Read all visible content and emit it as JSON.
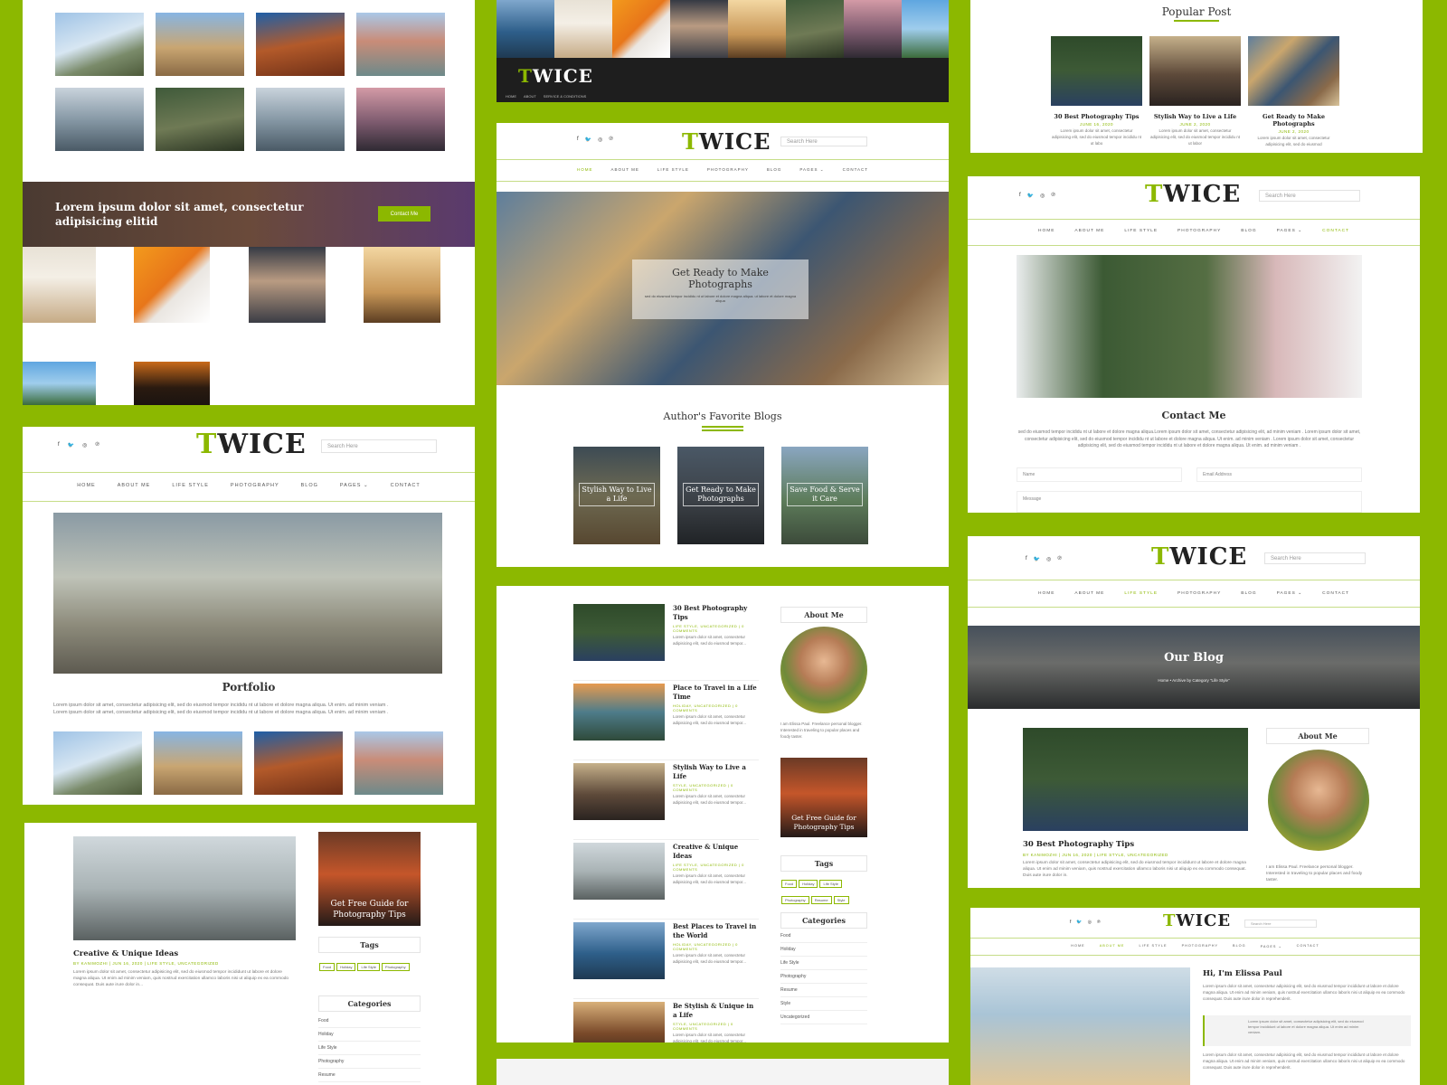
{
  "brand": {
    "logo_t": "T",
    "logo_rest": "WICE",
    "accent": "#8cb800",
    "background": "#8cb800"
  },
  "nav": {
    "home": "HOME",
    "about": "ABOUT ME",
    "lifestyle": "LIFE STYLE",
    "photography": "PHOTOGRAPHY",
    "blog": "BLOG",
    "pages": "PAGES ⌄",
    "contact": "CONTACT"
  },
  "topnav_small": {
    "a": "HOME",
    "b": "ABOUT",
    "c": "SERVICE & CONDITIONS"
  },
  "search": {
    "placeholder": "Search Here",
    "placeholder_small": "Search Here"
  },
  "social": {
    "facebook": "f",
    "twitter": "🐦",
    "instagram": "◎",
    "pinterest": "℗"
  },
  "banner": {
    "text": "Lorem ipsum dolor sit amet, consectetur adipisicing elitid",
    "button": "Contact Me"
  },
  "hero": {
    "title": "Get Ready to Make Photographs",
    "text": "sed do eiusmod tempor incididu nt ut labore et dolore magna aliqua. ut labore et dolore magna aliqua"
  },
  "author_section": {
    "title": "Author's Favorite Blogs",
    "cards": [
      "Stylish Way to Live a Life",
      "Get Ready to Make Photographs",
      "Save Food & Serve it Care"
    ]
  },
  "portfolio": {
    "title": "Portfolio",
    "text1": "Lorem ipsum dolor sit amet, consectetur adipisicing elit, sed do eiusmod tempor incididu nt ut labore et dolore magna aliqua. Ut enim. ad minim veniam .",
    "text2": "Lorem ipsum dolor sit amet, consectetur adipisicing elit, sed do eiusmod tempor incididu nt ut labore et dolore magna aliqua. Ut enim. ad minim veniam ."
  },
  "popular": {
    "title": "Popular Post",
    "posts": [
      {
        "title": "30 Best Photography Tips",
        "date": "JUNE 16, 2020",
        "text": "Lorem ipsum dolor sit amet, consectetur adipisicing elit, sed do eiusmod tempor incididu nt ut labo"
      },
      {
        "title": "Stylish Way to Live a Life",
        "date": "JUNE 2, 2020",
        "text": "Lorem ipsum dolor sit amet, consectetur adipisicing elit, sed do eiusmod tempor incididu nt ut labor"
      },
      {
        "title": "Get Ready to Make Photographs",
        "date": "JUNE 2, 2020",
        "text": "Lorem ipsum dolor sit amet, consectetur adipisicing elit, sed do eiusmod"
      }
    ]
  },
  "contact": {
    "title": "Contact Me",
    "text": "sed do eiusmod tempor incididu nt ut labore et dolore magna aliqua.Lorem ipsum dolor sit amet, consectetur adipisicing elit, ad minim veniam . Lorem ipsum dolor sit amet, consectetur adipisicing elit, sed do eiusmod tempor incididu nt ut labore et dolore magna aliqua. Ut enim. ad minim veniam . Lorem ipsum dolor sit amet, consectetur adipisicing elit, sed do eiusmod tempor incididu nt ut labore et dolore magna aliqua. Ut enim. ad minim veniam .",
    "name": "Name",
    "email": "Email Address",
    "message": "Message"
  },
  "ourblog": {
    "title": "Our Blog",
    "crumb": "Home  •  Archive by Category \"Life Style\""
  },
  "blogpost": {
    "title": "30 Best Photography Tips",
    "meta": "BY KANIMOZHI | JUN 16, 2020 | LIFE STYLE, UNCATEGORIZED",
    "text": "Lorem ipsum dolor sit amet, consectetur adipisicing elit, sed do eiusmod tempor incididunt ut labore et dolore magna aliqua. Ut enim ad minim veniam, quis nostrud exercitation ullamco laboris nisi ut aliquip ex ea commodo consequat. Duis aute irure dolor in."
  },
  "about": {
    "title": "About Me",
    "text": "I am Elissa Paul. Freelance personal blogger. Interested in traveling to popular places and foody taster."
  },
  "hi": {
    "title": "Hi, I'm Elissa Paul",
    "text": "Lorem ipsum dolor sit amet, consectetur adipisicing elit, sed do eiusmod tempor incididunt ut labore et dolore magna aliqua. Ut enim ad minim veniam, quis nostrud exercitation ullamco laboris nisi ut aliquip ex ea commodo consequat. Duis aute irure dolor in reprehenderit.",
    "quote": "Lorem ipsum dolor sit amet, consectetur adipisicing elit, sed do eiusmod tempor incididunt ut labore et dolore magna aliqua. Ut enim ad minim veniam."
  },
  "list": {
    "posts": [
      {
        "title": "30 Best Photography Tips",
        "meta": "LIFE STYLE, UNCATEGORIZED | 0 COMMENTS"
      },
      {
        "title": "Place to Travel in a Life Time",
        "meta": "HOLIDAY, UNCATEGORIZED | 0 COMMENTS"
      },
      {
        "title": "Stylish Way to Live a Life",
        "meta": "STYLE, UNCATEGORIZED | 0 COMMENTS"
      },
      {
        "title": "Creative & Unique Ideas",
        "meta": "LIFE STYLE, UNCATEGORIZED | 0 COMMENTS"
      },
      {
        "title": "Best Places to Travel in the World",
        "meta": "HOLIDAY, UNCATEGORIZED | 0 COMMENTS"
      },
      {
        "title": "Be Stylish & Unique in a Life",
        "meta": "STYLE, UNCATEGORIZED | 0 COMMENTS"
      }
    ],
    "excerpt": "Lorem ipsum dolor sit amet, consectetur adipisicing elit, sed do eiusmod tempor..."
  },
  "sidebar": {
    "about": "About Me",
    "guide": "Get Free Guide for Photography Tips",
    "tags_title": "Tags",
    "tags": [
      "Food",
      "Holiday",
      "Life Style",
      "Photography",
      "Resume",
      "Style"
    ],
    "cat_title": "Categories",
    "cats": [
      "Food",
      "Holiday",
      "Life Style",
      "Photography",
      "Resume",
      "Style",
      "Uncategorized"
    ]
  },
  "creative": {
    "title": "Creative & Unique Ideas",
    "meta": "BY KANIMOZHI | JUN 16, 2020 | LIFE STYLE, UNCATEGORIZED",
    "text": "Lorem ipsum dolor sit amet, consectetur adipisicing elit, sed do eiusmod tempor incididunt ut labore et dolore magna aliqua. Ut enim ad minim veniam, quis nostrud exercitation ullamco laboris nisi ut aliquip ex ea commodo consequat. Duis aute irure dolor in..."
  }
}
